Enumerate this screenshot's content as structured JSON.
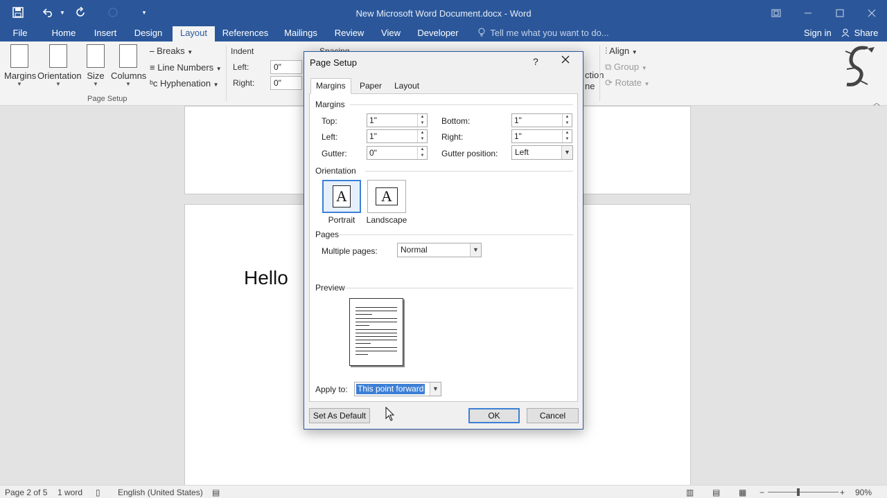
{
  "window": {
    "title": "New Microsoft Word Document.docx - Word",
    "controls": [
      "restore-icon",
      "minimize-icon",
      "maximize-icon",
      "close-icon"
    ]
  },
  "qat": {
    "icons": [
      "save-icon",
      "undo-icon",
      "redo-icon",
      "touch-mode-icon",
      "customize-qat-icon"
    ]
  },
  "menu": {
    "tabs": [
      "File",
      "Home",
      "Insert",
      "Design",
      "Layout",
      "References",
      "Mailings",
      "Review",
      "View",
      "Developer"
    ],
    "active": "Layout",
    "tell_me": "Tell me what you want to do...",
    "sign_in": "Sign in",
    "share": "Share"
  },
  "ribbon": {
    "page_setup": {
      "margins": "Margins",
      "orientation": "Orientation",
      "size": "Size",
      "columns": "Columns",
      "breaks": "Breaks",
      "line_numbers": "Line Numbers",
      "hyphenation": "Hyphenation",
      "group_label": "Page Setup"
    },
    "paragraph": {
      "indent_label": "Indent",
      "spacing_label": "Spacing",
      "left_label": "Left:",
      "right_label": "Right:",
      "left_value": "0\"",
      "right_value": "0\""
    },
    "arrange": {
      "selection_partial": "ction",
      "pane_partial": "ne",
      "align": "Align",
      "group": "Group",
      "rotate": "Rotate"
    }
  },
  "document": {
    "text": "Hello"
  },
  "status": {
    "page": "Page 2 of 5",
    "words": "1 word",
    "language": "English (United States)",
    "zoom": "90%"
  },
  "dialog": {
    "title": "Page Setup",
    "help": "?",
    "tabs": [
      "Margins",
      "Paper",
      "Layout"
    ],
    "active_tab": "Margins",
    "margins_section": "Margins",
    "fields": {
      "top_label": "Top:",
      "top_value": "1\"",
      "bottom_label": "Bottom:",
      "bottom_value": "1\"",
      "left_label": "Left:",
      "left_value": "1\"",
      "right_label": "Right:",
      "right_value": "1\"",
      "gutter_label": "Gutter:",
      "gutter_value": "0\"",
      "gutter_pos_label": "Gutter position:",
      "gutter_pos_value": "Left"
    },
    "orientation_section": "Orientation",
    "portrait": "Portrait",
    "landscape": "Landscape",
    "orientation_glyph": "A",
    "pages_section": "Pages",
    "multiple_pages_label": "Multiple pages:",
    "multiple_pages_value": "Normal",
    "preview_section": "Preview",
    "apply_to_label": "Apply to:",
    "apply_to_value": "This point forward",
    "buttons": {
      "set_default": "Set As Default",
      "ok": "OK",
      "cancel": "Cancel"
    }
  }
}
